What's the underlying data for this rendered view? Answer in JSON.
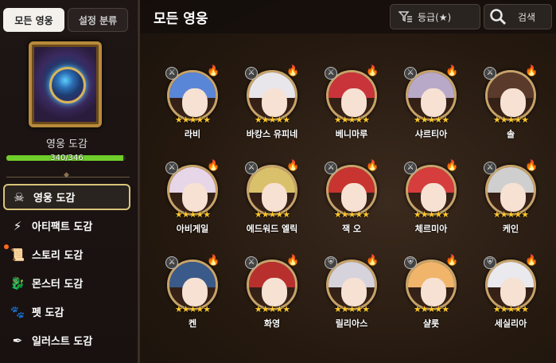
{
  "tabs": {
    "all_heroes": "모든 영웅",
    "settings_class": "설정 분류"
  },
  "codex": {
    "title": "영웅 도감",
    "progress_text": "340/346",
    "progress_fraction": 0.983
  },
  "menu": [
    {
      "label": "영웅 도감",
      "icon": "hero-icon",
      "active": true
    },
    {
      "label": "아티팩트 도감",
      "icon": "lightning-icon",
      "active": false
    },
    {
      "label": "스토리 도감",
      "icon": "scroll-icon",
      "active": false,
      "notification": true
    },
    {
      "label": "몬스터 도감",
      "icon": "dragon-icon",
      "active": false
    },
    {
      "label": "펫 도감",
      "icon": "paw-icon",
      "active": false
    },
    {
      "label": "일러스트 도감",
      "icon": "quill-icon",
      "active": false
    }
  ],
  "header": {
    "title": "모든 영웅",
    "filter_label": "등급(★)",
    "search_label": "검색"
  },
  "heroes": [
    {
      "name": "라비",
      "hair": "#5a86d8",
      "badge": "swords"
    },
    {
      "name": "바캉스 유피네",
      "hair": "#e8e6ea",
      "badge": "swords"
    },
    {
      "name": "베니마루",
      "hair": "#c9343a",
      "badge": "swords"
    },
    {
      "name": "샤르티아",
      "hair": "#b8a9c9",
      "badge": "swords"
    },
    {
      "name": "솔",
      "hair": "#5a3a2a",
      "badge": "swords"
    },
    {
      "name": "아비게일",
      "hair": "#e7d6e8",
      "badge": "swords"
    },
    {
      "name": "에드워드 엘릭",
      "hair": "#d9c06a",
      "badge": "swords"
    },
    {
      "name": "잭 오",
      "hair": "#c8342f",
      "badge": "swords"
    },
    {
      "name": "체르미아",
      "hair": "#d63d3d",
      "badge": "swords"
    },
    {
      "name": "케인",
      "hair": "#cfcfcf",
      "badge": "swords"
    },
    {
      "name": "켄",
      "hair": "#3a5a8a",
      "badge": "swords"
    },
    {
      "name": "화영",
      "hair": "#b8302e",
      "badge": "swords"
    },
    {
      "name": "릴리아스",
      "hair": "#d6d3dc",
      "badge": "shield"
    },
    {
      "name": "샬롯",
      "hair": "#f0b56a",
      "badge": "shield"
    },
    {
      "name": "세실리아",
      "hair": "#e9e9ee",
      "badge": "shield"
    }
  ],
  "colors": {
    "accent_gold": "#d9c47a",
    "progress_green": "#6fce2a",
    "star_yellow": "#ffc82a"
  }
}
